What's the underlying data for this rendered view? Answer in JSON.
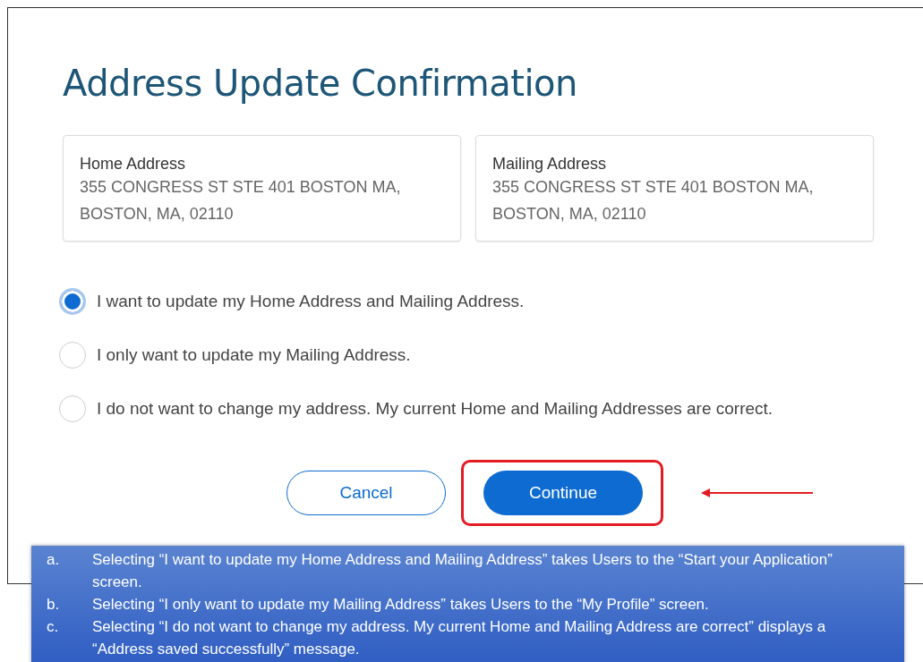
{
  "title": "Address Update Confirmation",
  "cards": [
    {
      "heading": "Home Address",
      "lines": [
        "355 CONGRESS ST STE 401 BOSTON MA,",
        "BOSTON, MA, 02110"
      ]
    },
    {
      "heading": "Mailing Address",
      "lines": [
        "355 CONGRESS ST STE 401 BOSTON MA,",
        "BOSTON, MA, 02110"
      ]
    }
  ],
  "options": [
    {
      "label": "I want to update my Home Address and Mailing Address.",
      "selected": true
    },
    {
      "label": "I only want to update my Mailing Address.",
      "selected": false
    },
    {
      "label": "I do not want to change my address. My current Home and Mailing Addresses are correct.",
      "selected": false
    }
  ],
  "buttons": [
    {
      "label": "Cancel",
      "kind": "secondary",
      "highlighted": false
    },
    {
      "label": "Continue",
      "kind": "primary",
      "highlighted": true
    }
  ],
  "notes": [
    {
      "marker": "a.",
      "text": "Selecting “I want to update my Home Address and Mailing Address” takes Users to the “Start your Application” screen."
    },
    {
      "marker": "b.",
      "text": "Selecting “I only want to update my Mailing Address” takes Users to the “My Profile” screen."
    },
    {
      "marker": "c.",
      "text": "Selecting “I do not want to change my address. My current Home and Mailing Address are correct” displays a “Address saved successfully” message."
    }
  ]
}
